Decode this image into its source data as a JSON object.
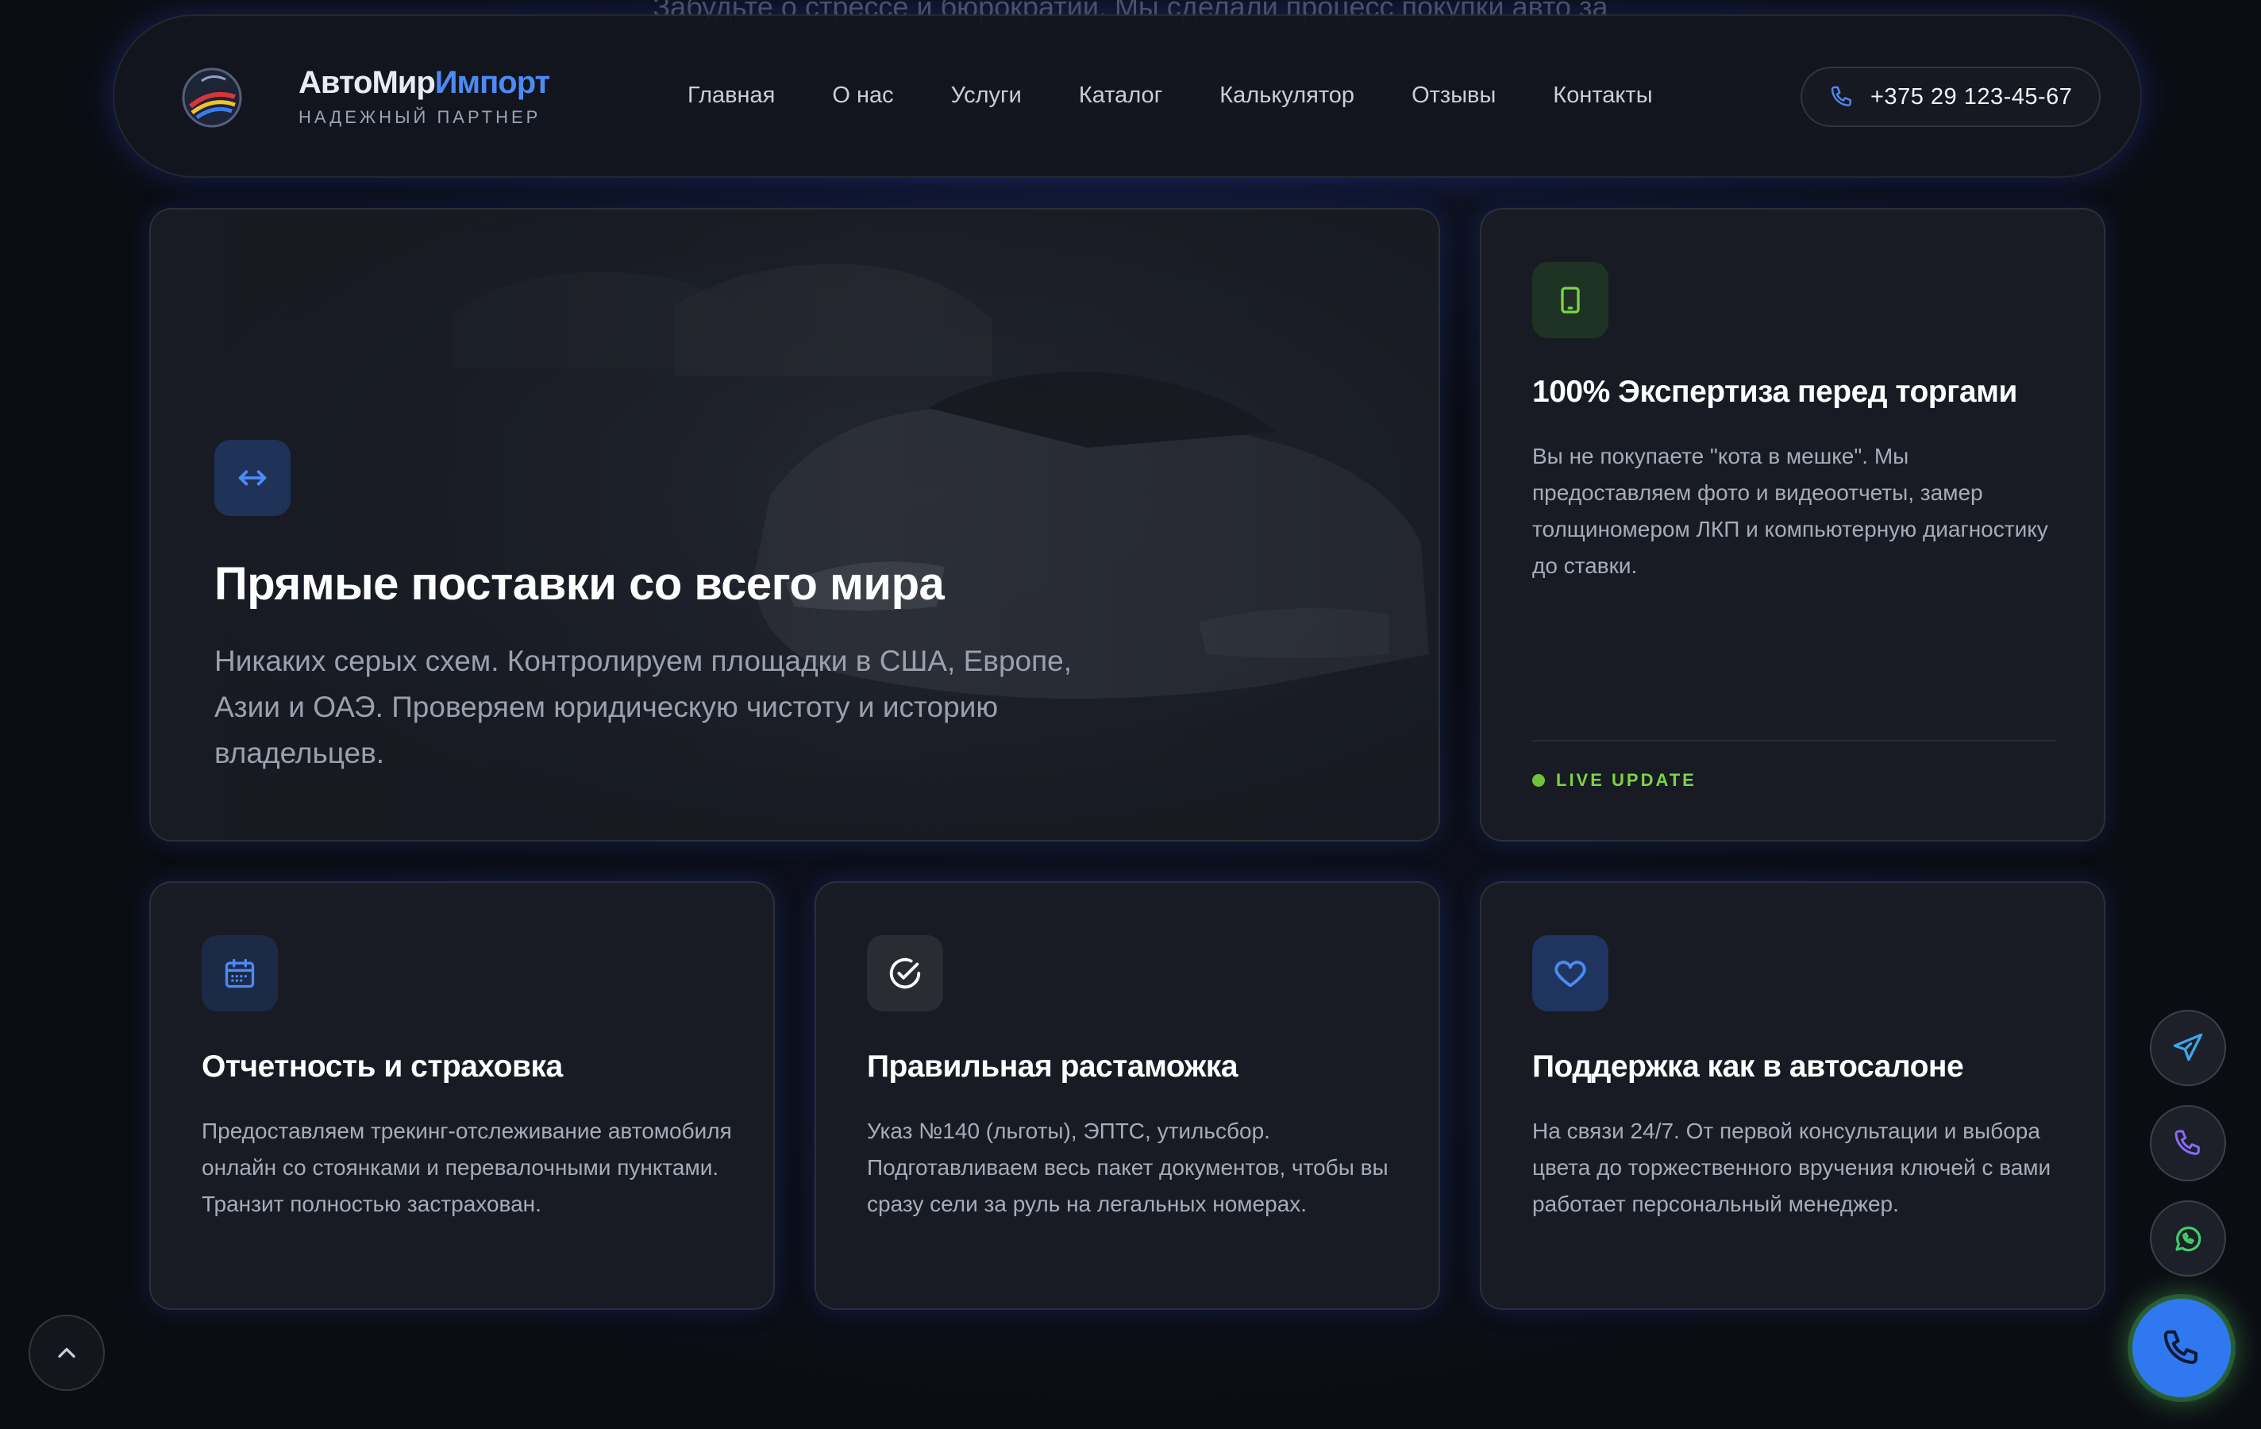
{
  "background_text": "Забудьте о стрессе и бюрократии. Мы сделали процесс покупки авто за",
  "header": {
    "brand_main": "АвтоМир",
    "brand_accent": "Импорт",
    "brand_tagline": "НАДЕЖНЫЙ ПАРТНЕР",
    "nav": [
      "Главная",
      "О нас",
      "Услуги",
      "Каталог",
      "Калькулятор",
      "Отзывы",
      "Контакты"
    ],
    "phone": "+375 29 123-45-67",
    "logo_icon": "globe-emblem-icon"
  },
  "cards": {
    "hero": {
      "icon": "arrows-left-right-icon",
      "title": "Прямые поставки со всего мира",
      "text": "Никаких серых схем. Контролируем площадки в США, Европе, Азии и ОАЭ. Проверяем юридическую чистоту и историю владельцев."
    },
    "expertise": {
      "icon": "tablet-icon",
      "title": "100% Экспертиза перед торгами",
      "text": "Вы не покупаете \"кота в мешке\". Мы предоставляем фото и видеоотчеты, замер толщиномером ЛКП и компьютерную диагностику до ставки.",
      "live_label": "LIVE UPDATE"
    },
    "report": {
      "icon": "calendar-icon",
      "title": "Отчетность и страховка",
      "text": "Предоставляем трекинг-отслеживание автомобиля онлайн со стоянками и перевалочными пунктами. Транзит полностью застрахован."
    },
    "customs": {
      "icon": "check-circle-icon",
      "title": "Правильная растаможка",
      "text": "Указ №140 (льготы), ЭПТС, утильсбор. Подготавливаем весь пакет документов, чтобы вы сразу сели за руль на легальных номерах."
    },
    "support": {
      "icon": "heart-icon",
      "title": "Поддержка как в автосалоне",
      "text": "На связи 24/7. От первой консультации и выбора цвета до торжественного вручения ключей с вами работает персональный менеджер."
    }
  },
  "floating": {
    "telegram_icon": "telegram-icon",
    "phone_icon": "phone-icon",
    "whatsapp_icon": "whatsapp-icon",
    "call_icon": "phone-icon",
    "scroll_top_icon": "chevron-up-icon"
  },
  "colors": {
    "accent_blue": "#4d8af5",
    "live_green": "#7ed444",
    "call_button": "#2f78f0"
  }
}
